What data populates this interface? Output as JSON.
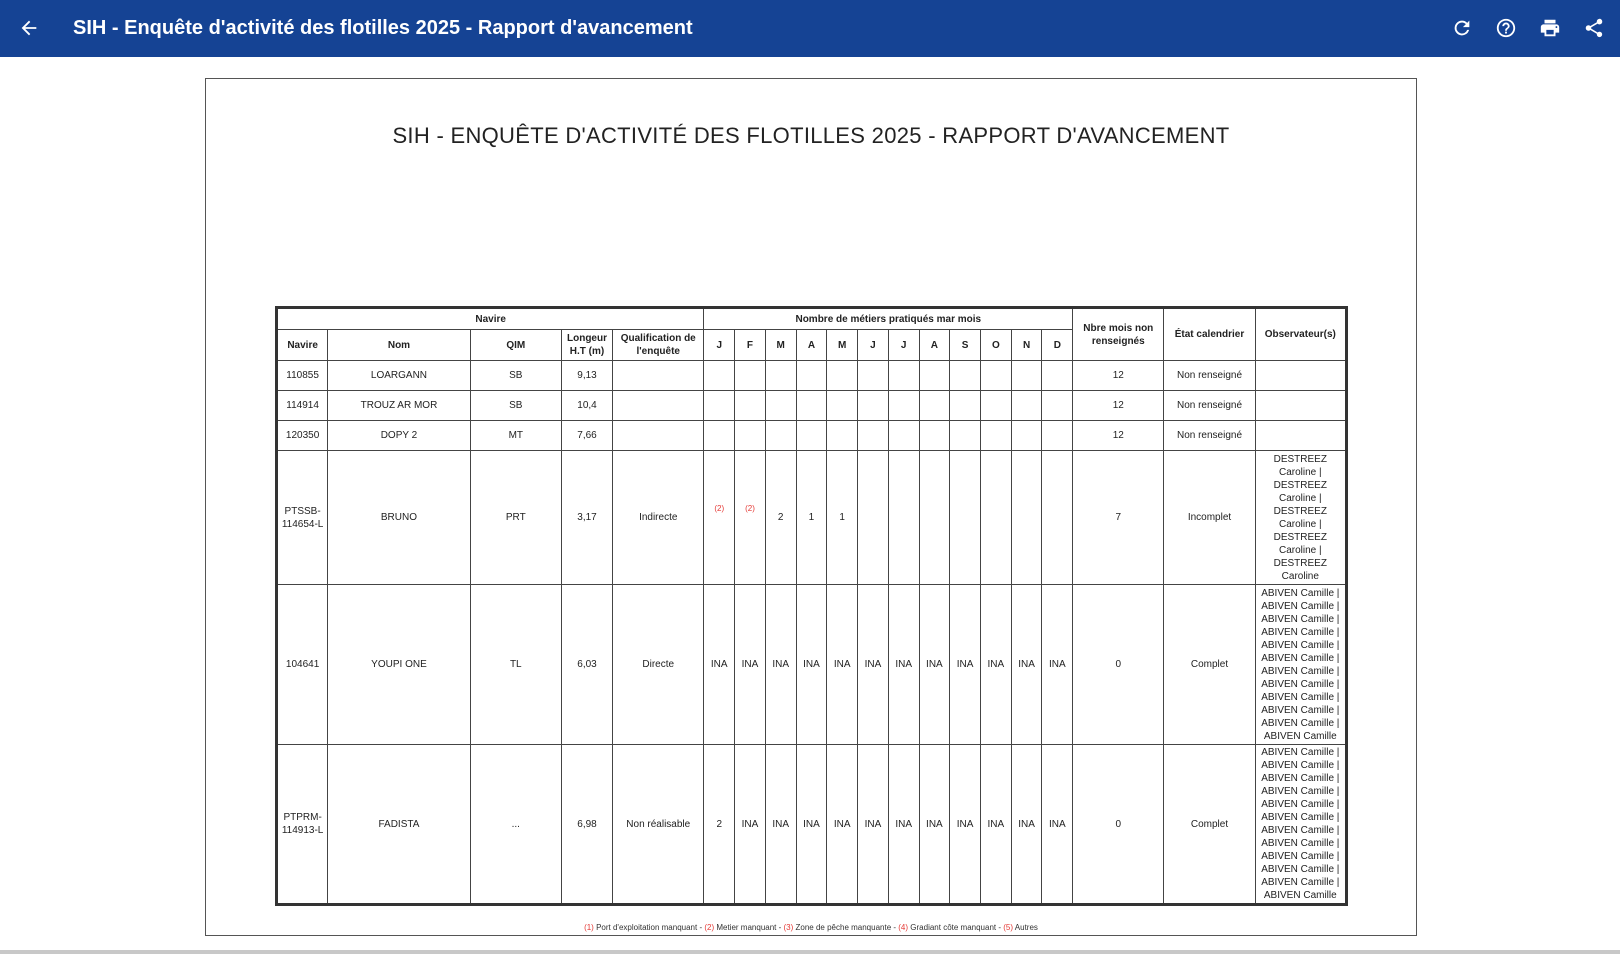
{
  "toolbar": {
    "title": "SIH - Enquête d'activité des flotilles 2025 - Rapport d'avancement",
    "back_icon": "arrow-left-icon",
    "actions": [
      "refresh-icon",
      "help-icon",
      "print-icon",
      "share-icon"
    ]
  },
  "report": {
    "title": "SIH - ENQUÊTE D'ACTIVITÉ DES FLOTILLES 2025 - RAPPORT D'AVANCEMENT",
    "group_headers": {
      "navire": "Navire",
      "metiers": "Nombre de métiers pratiqués mar mois"
    },
    "columns": {
      "navire": "Navire",
      "nom": "Nom",
      "qim": "QIM",
      "longueur": "Longeur H.T (m)",
      "qualification": "Qualification de l'enquête",
      "months": [
        "J",
        "F",
        "M",
        "A",
        "M",
        "J",
        "J",
        "A",
        "S",
        "O",
        "N",
        "D"
      ],
      "nbre_mois": "Nbre mois non renseignés",
      "etat": "État calendrier",
      "observateurs": "Observateur(s)"
    },
    "rows": [
      {
        "navire": "110855",
        "nom": "LOARGANN",
        "qim": "SB",
        "longueur": "9,13",
        "qualification": "",
        "months": [
          "",
          "",
          "",
          "",
          "",
          "",
          "",
          "",
          "",
          "",
          "",
          ""
        ],
        "nbre": "12",
        "etat": "Non renseigné",
        "observateurs": ""
      },
      {
        "navire": "114914",
        "nom": "TROUZ AR MOR",
        "qim": "SB",
        "longueur": "10,4",
        "qualification": "",
        "months": [
          "",
          "",
          "",
          "",
          "",
          "",
          "",
          "",
          "",
          "",
          "",
          ""
        ],
        "nbre": "12",
        "etat": "Non renseigné",
        "observateurs": ""
      },
      {
        "navire": "120350",
        "nom": "DOPY 2",
        "qim": "MT",
        "longueur": "7,66",
        "qualification": "",
        "months": [
          "",
          "",
          "",
          "",
          "",
          "",
          "",
          "",
          "",
          "",
          "",
          ""
        ],
        "nbre": "12",
        "etat": "Non renseigné",
        "observateurs": ""
      },
      {
        "navire": "PTSSB-114654-L",
        "nom": "BRUNO",
        "qim": "PRT",
        "longueur": "3,17",
        "qualification": "Indirecte",
        "months": [
          "(2)",
          "(2)",
          "2",
          "1",
          "1",
          "",
          "",
          "",
          "",
          "",
          "",
          ""
        ],
        "nbre": "7",
        "etat": "Incomplet",
        "observateurs": "DESTREEZ Caroline | DESTREEZ Caroline | DESTREEZ Caroline | DESTREEZ Caroline | DESTREEZ Caroline"
      },
      {
        "navire": "104641",
        "nom": "YOUPI ONE",
        "qim": "TL",
        "longueur": "6,03",
        "qualification": "Directe",
        "months": [
          "INA",
          "INA",
          "INA",
          "INA",
          "INA",
          "INA",
          "INA",
          "INA",
          "INA",
          "INA",
          "INA",
          "INA"
        ],
        "nbre": "0",
        "etat": "Complet",
        "observateurs": "ABIVEN Camille | ABIVEN Camille | ABIVEN Camille | ABIVEN Camille | ABIVEN Camille | ABIVEN Camille | ABIVEN Camille | ABIVEN Camille | ABIVEN Camille | ABIVEN Camille | ABIVEN Camille | ABIVEN Camille"
      },
      {
        "navire": "PTPRM-114913-L",
        "nom": "FADISTA",
        "qim": "...",
        "longueur": "6,98",
        "qualification": "Non réalisable",
        "months": [
          "2",
          "INA",
          "INA",
          "INA",
          "INA",
          "INA",
          "INA",
          "INA",
          "INA",
          "INA",
          "INA",
          "INA"
        ],
        "nbre": "0",
        "etat": "Complet",
        "observateurs": "ABIVEN Camille | ABIVEN Camille | ABIVEN Camille | ABIVEN Camille | ABIVEN Camille | ABIVEN Camille | ABIVEN Camille | ABIVEN Camille | ABIVEN Camille | ABIVEN Camille | ABIVEN Camille | ABIVEN Camille"
      }
    ],
    "legend": [
      {
        "num": "(1)",
        "label": "Port d'exploitation manquant"
      },
      {
        "num": "(2)",
        "label": "Metier manquant"
      },
      {
        "num": "(3)",
        "label": "Zone de pêche manquante"
      },
      {
        "num": "(4)",
        "label": "Gradiant côte manquant"
      },
      {
        "num": "(5)",
        "label": "Autres"
      }
    ]
  }
}
